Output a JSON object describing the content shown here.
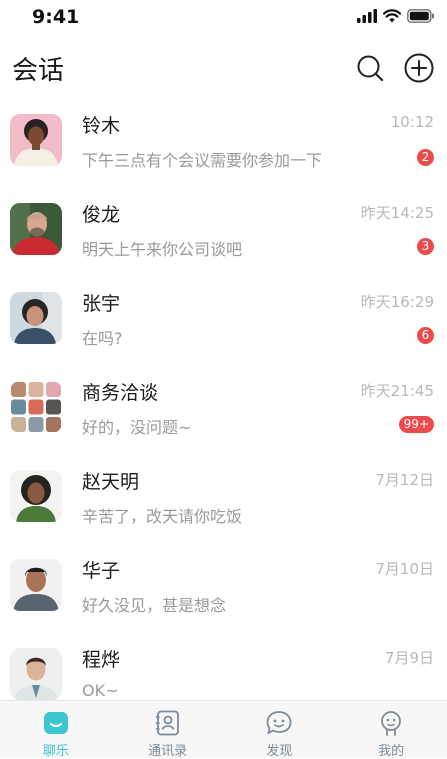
{
  "status_bar": {
    "time": "9:41"
  },
  "header": {
    "title": "会话",
    "search_icon": "search-icon",
    "add_icon": "plus-circle-icon"
  },
  "chats": [
    {
      "name": "铃木",
      "preview": "下午三点有个会议需要你参加一下",
      "time": "10:12",
      "badge": "2"
    },
    {
      "name": "俊龙",
      "preview": "明天上午来你公司谈吧",
      "time": "昨天14:25",
      "badge": "3"
    },
    {
      "name": "张宇",
      "preview": "在吗?",
      "time": "昨天16:29",
      "badge": "6"
    },
    {
      "name": "商务洽谈",
      "preview": "好的，没问题~",
      "time": "昨天21:45",
      "badge": "99+"
    },
    {
      "name": "赵天明",
      "preview": "辛苦了，改天请你吃饭",
      "time": "7月12日",
      "badge": ""
    },
    {
      "name": "华子",
      "preview": "好久没见，甚是想念",
      "time": "7月10日",
      "badge": ""
    },
    {
      "name": "程烨",
      "preview": "OK~",
      "time": "7月9日",
      "badge": ""
    }
  ],
  "tabs": [
    {
      "label": "聊乐",
      "icon": "chat-bubble-icon",
      "active": true
    },
    {
      "label": "通讯录",
      "icon": "contacts-icon",
      "active": false
    },
    {
      "label": "发现",
      "icon": "discover-icon",
      "active": false
    },
    {
      "label": "我的",
      "icon": "profile-icon",
      "active": false
    }
  ],
  "colors": {
    "accent": "#3ec6cf",
    "badge": "#ec4b4b",
    "muted": "#9a9a9a",
    "time": "#b9b9b9"
  }
}
